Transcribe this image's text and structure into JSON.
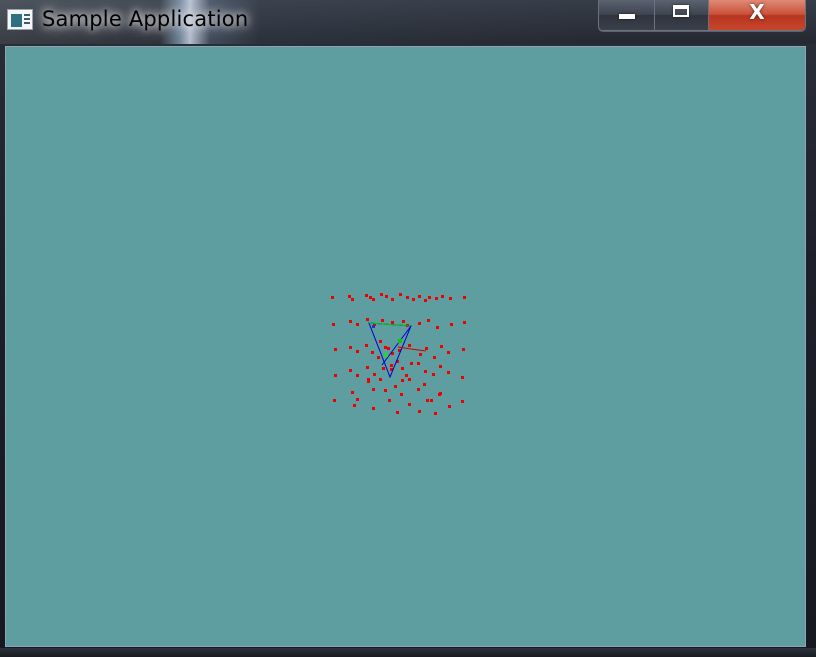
{
  "window": {
    "title": "Sample Application",
    "icon": "application-window-icon"
  },
  "caption_buttons": {
    "minimize_icon": "minimize-icon",
    "maximize_icon": "maximize-icon",
    "close_glyph": "X"
  },
  "viewport": {
    "background_color": "#5f9ea0"
  },
  "scene": {
    "point_color": "#ee0000",
    "triangle_blue": "#0000cc",
    "triangle_green": "#00cc00",
    "ray_color": "#cc0000"
  }
}
